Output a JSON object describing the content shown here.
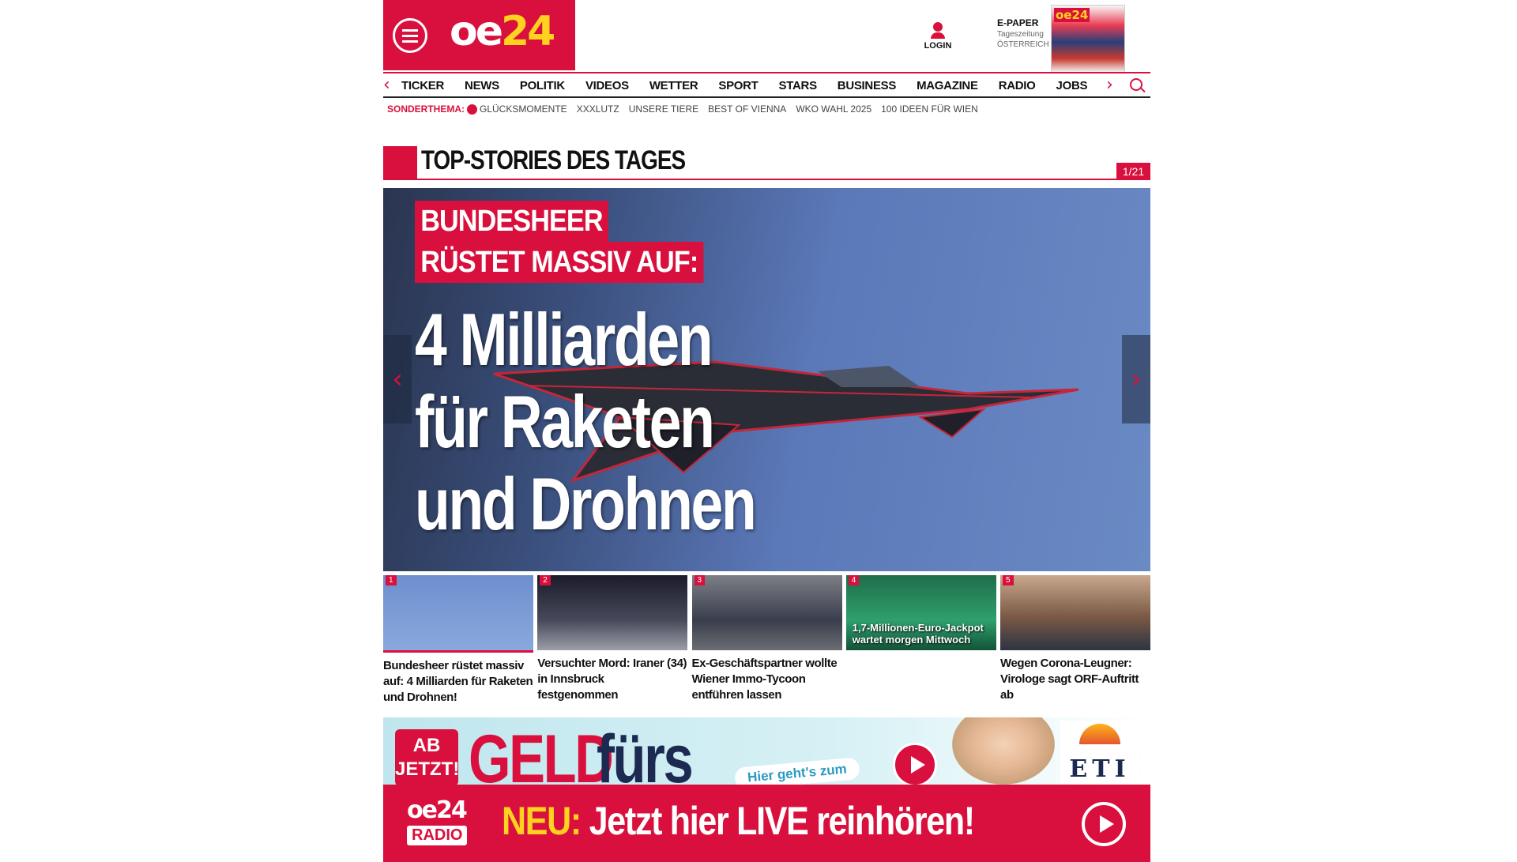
{
  "header": {
    "logo_text": "oe",
    "logo_num": "24",
    "login_label": "LOGIN",
    "epaper": {
      "title": "E-PAPER",
      "line1": "Tageszeitung",
      "line2": "ÖSTERREICH",
      "cover_logo": "oe24"
    }
  },
  "nav": {
    "items": [
      "TICKER",
      "NEWS",
      "POLITIK",
      "VIDEOS",
      "WETTER",
      "SPORT",
      "STARS",
      "BUSINESS",
      "MAGAZINE",
      "RADIO",
      "JOBS"
    ],
    "chev_left": "‹",
    "chev_right": "›"
  },
  "subnav": {
    "lead": "SONDERTHEMA:",
    "items": [
      "GLÜCKSMOMENTE",
      "XXXLUTZ",
      "UNSERE TIERE",
      "BEST OF VIENNA",
      "WKO WAHL 2025",
      "100 IDEEN FÜR WIEN"
    ]
  },
  "section": {
    "title": "TOP-STORIES DES TAGES",
    "counter": "1/21"
  },
  "hero": {
    "kicker_line1": "BUNDESHEER",
    "kicker_line2": "RÜSTET MASSIV AUF:",
    "title_line1": "4 Milliarden",
    "title_line2": "für Raketen",
    "title_line3": "und Drohnen",
    "arrow_left": "‹",
    "arrow_right": "›"
  },
  "thumbnails": [
    {
      "num": "1",
      "caption": "Bundesheer rüstet massiv auf: 4 Milliarden für Raketen und Drohnen!",
      "overlay": ""
    },
    {
      "num": "2",
      "caption": "Versuchter Mord: Iraner (34) in Innsbruck festgenommen",
      "overlay": ""
    },
    {
      "num": "3",
      "caption": "Ex-Geschäftspartner wollte Wiener Immo-Tycoon entführen lassen",
      "overlay": ""
    },
    {
      "num": "4",
      "caption": "",
      "overlay": "1,7-Millionen-Euro-Jackpot wartet morgen Mittwoch"
    },
    {
      "num": "5",
      "caption": "Wegen Corona-Leugner: Virologe sagt ORF-Auftritt ab",
      "overlay": ""
    }
  ],
  "ad": {
    "ab_jetzt": "AB JETZT!",
    "geld": "GELD",
    "furs": "fürs",
    "pill": "Hier geht's zum",
    "eti": "ETI"
  },
  "radio": {
    "logo": "oe24",
    "badge": "RADIO",
    "neu": "NEU:",
    "text": " Jetzt hier LIVE reinhören!"
  },
  "colors": {
    "brand_red": "#d9103d",
    "brand_yellow": "#ffd21f"
  }
}
